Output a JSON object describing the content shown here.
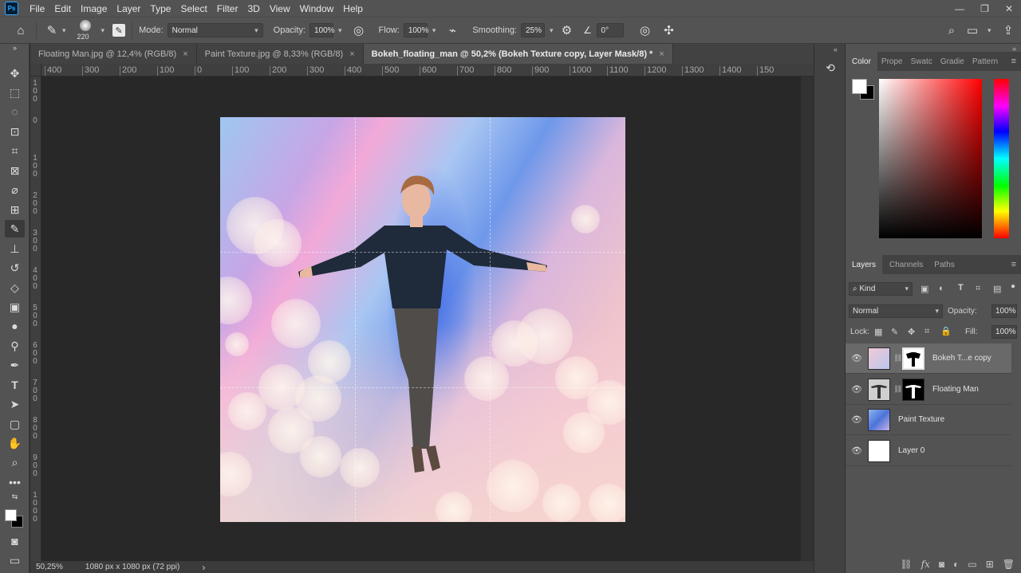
{
  "menu": {
    "items": [
      "File",
      "Edit",
      "Image",
      "Layer",
      "Type",
      "Select",
      "Filter",
      "3D",
      "View",
      "Window",
      "Help"
    ],
    "window_controls": [
      "—",
      "❐",
      "✕"
    ]
  },
  "options": {
    "brush_size": "220",
    "mode_label": "Mode:",
    "mode_value": "Normal",
    "opacity_label": "Opacity:",
    "opacity_value": "100%",
    "flow_label": "Flow:",
    "flow_value": "100%",
    "smoothing_label": "Smoothing:",
    "smoothing_value": "25%",
    "angle_value": "0°"
  },
  "tabs": [
    {
      "title": "Floating Man.jpg @ 12,4% (RGB/8)",
      "close": "×"
    },
    {
      "title": "Paint Texture.jpg @ 8,33% (RGB/8)",
      "close": "×"
    },
    {
      "title": "Bokeh_floating_man @ 50,2% (Bokeh Texture copy, Layer Mask/8) *",
      "close": "×"
    }
  ],
  "ruler_h_labels": [
    "400",
    "300",
    "200",
    "100",
    "0",
    "100",
    "200",
    "300",
    "400",
    "500",
    "600",
    "700",
    "800",
    "900",
    "1000",
    "1100",
    "1200",
    "1300",
    "1400",
    "150"
  ],
  "ruler_v_labels": [
    "100",
    "0",
    "100",
    "200",
    "300",
    "400",
    "500",
    "600",
    "700",
    "800",
    "900",
    "1000"
  ],
  "status": {
    "zoom": "50,25%",
    "doc_size": "1080 px x 1080 px (72 ppi)",
    "arrow": "›"
  },
  "color_panel": {
    "tabs": [
      "Color",
      "Prope",
      "Swatc",
      "Gradie",
      "Pattern"
    ]
  },
  "layers_panel": {
    "tabs": [
      "Layers",
      "Channels",
      "Paths"
    ],
    "filter_label": "Kind",
    "blend_mode": "Normal",
    "opacity_label": "Opacity:",
    "opacity_value": "100%",
    "lock_label": "Lock:",
    "fill_label": "Fill:",
    "fill_value": "100%",
    "layers": [
      {
        "name": "Bokeh T...e copy"
      },
      {
        "name": "Floating Man"
      },
      {
        "name": "Paint Texture"
      },
      {
        "name": "Layer 0"
      }
    ]
  },
  "colors": {
    "ui_bg": "#535353",
    "dark_bg": "#282828",
    "accent": "#31a8ff"
  }
}
